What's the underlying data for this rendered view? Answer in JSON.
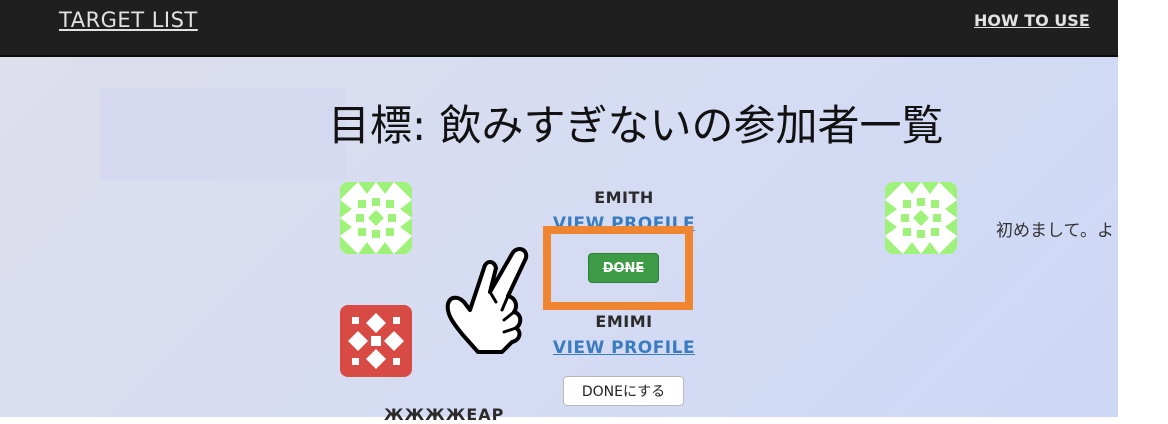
{
  "nav": {
    "brand": "TARGET LIST",
    "how_to_use": "HOW TO USE"
  },
  "page": {
    "title": "目標: 飲みすぎないの参加者一覧"
  },
  "participants": [
    {
      "name": "EMITH",
      "view_profile": "VIEW PROFILE",
      "action_label": "DONE",
      "status": "done"
    },
    {
      "name": "EMIMI",
      "view_profile": "VIEW PROFILE",
      "action_label": "DONEにする",
      "status": "pending"
    },
    {
      "name": "ЖЖЖЖЕАР"
    }
  ],
  "comment": {
    "text": "初めまして。よ"
  },
  "colors": {
    "header_bg": "#1f1f1f",
    "done_green": "#3d9b46",
    "highlight_orange": "#f08531",
    "link_blue": "#3a7cc0",
    "avatar_green": "#9ef27a",
    "avatar_red": "#d84a44"
  },
  "icons": {
    "pointer": "hand-pointer-icon",
    "avatar_pattern_green": "identicon-green",
    "avatar_pattern_red": "identicon-red"
  }
}
